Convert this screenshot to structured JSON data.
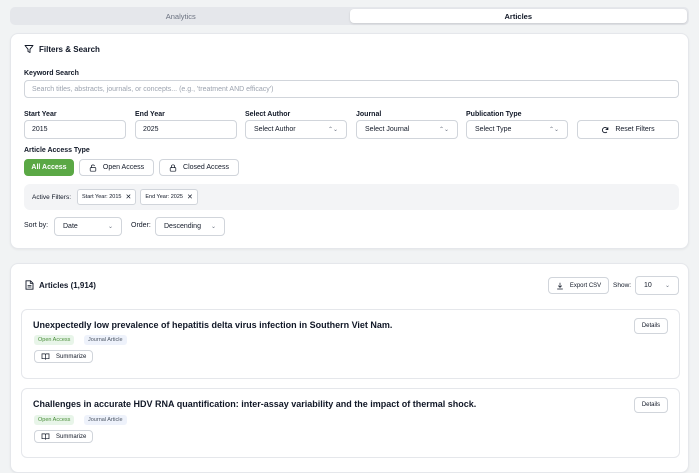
{
  "tabs": [
    {
      "label": "Analytics"
    },
    {
      "label": "Articles"
    }
  ],
  "filters": {
    "title": "Filters & Search",
    "keyword_label": "Keyword Search",
    "keyword_placeholder": "Search titles, abstracts, journals, or concepts... (e.g., 'treatment AND efficacy')",
    "start_year_label": "Start Year",
    "start_year_value": "2015",
    "end_year_label": "End Year",
    "end_year_value": "2025",
    "author_label": "Select Author",
    "author_value": "Select Author",
    "journal_label": "Journal",
    "journal_value": "Select Journal",
    "pubtype_label": "Publication Type",
    "pubtype_value": "Select Type",
    "reset_label": "Reset Filters",
    "access_label": "Article Access Type",
    "access_all": "All Access",
    "access_open": "Open Access",
    "access_closed": "Closed Access",
    "active_filters_label": "Active Filters:",
    "active_chips": [
      "Start Year: 2015",
      "End Year: 2025"
    ],
    "sort_label": "Sort by:",
    "sort_value": "Date",
    "order_label": "Order:",
    "order_value": "Descending"
  },
  "articles": {
    "title": "Articles (1,914)",
    "export_label": "Export CSV",
    "show_label": "Show:",
    "show_value": "10",
    "items": [
      {
        "title": "Unexpectedly low prevalence of hepatitis delta virus infection in Southern Viet Nam.",
        "access": "Open Access",
        "type": "Journal Article",
        "summarize": "Summarize",
        "details": "Details"
      },
      {
        "title": "Challenges in accurate HDV RNA quantification: inter-assay variability and the impact of thermal shock.",
        "access": "Open Access",
        "type": "Journal Article",
        "summarize": "Summarize",
        "details": "Details"
      }
    ]
  }
}
